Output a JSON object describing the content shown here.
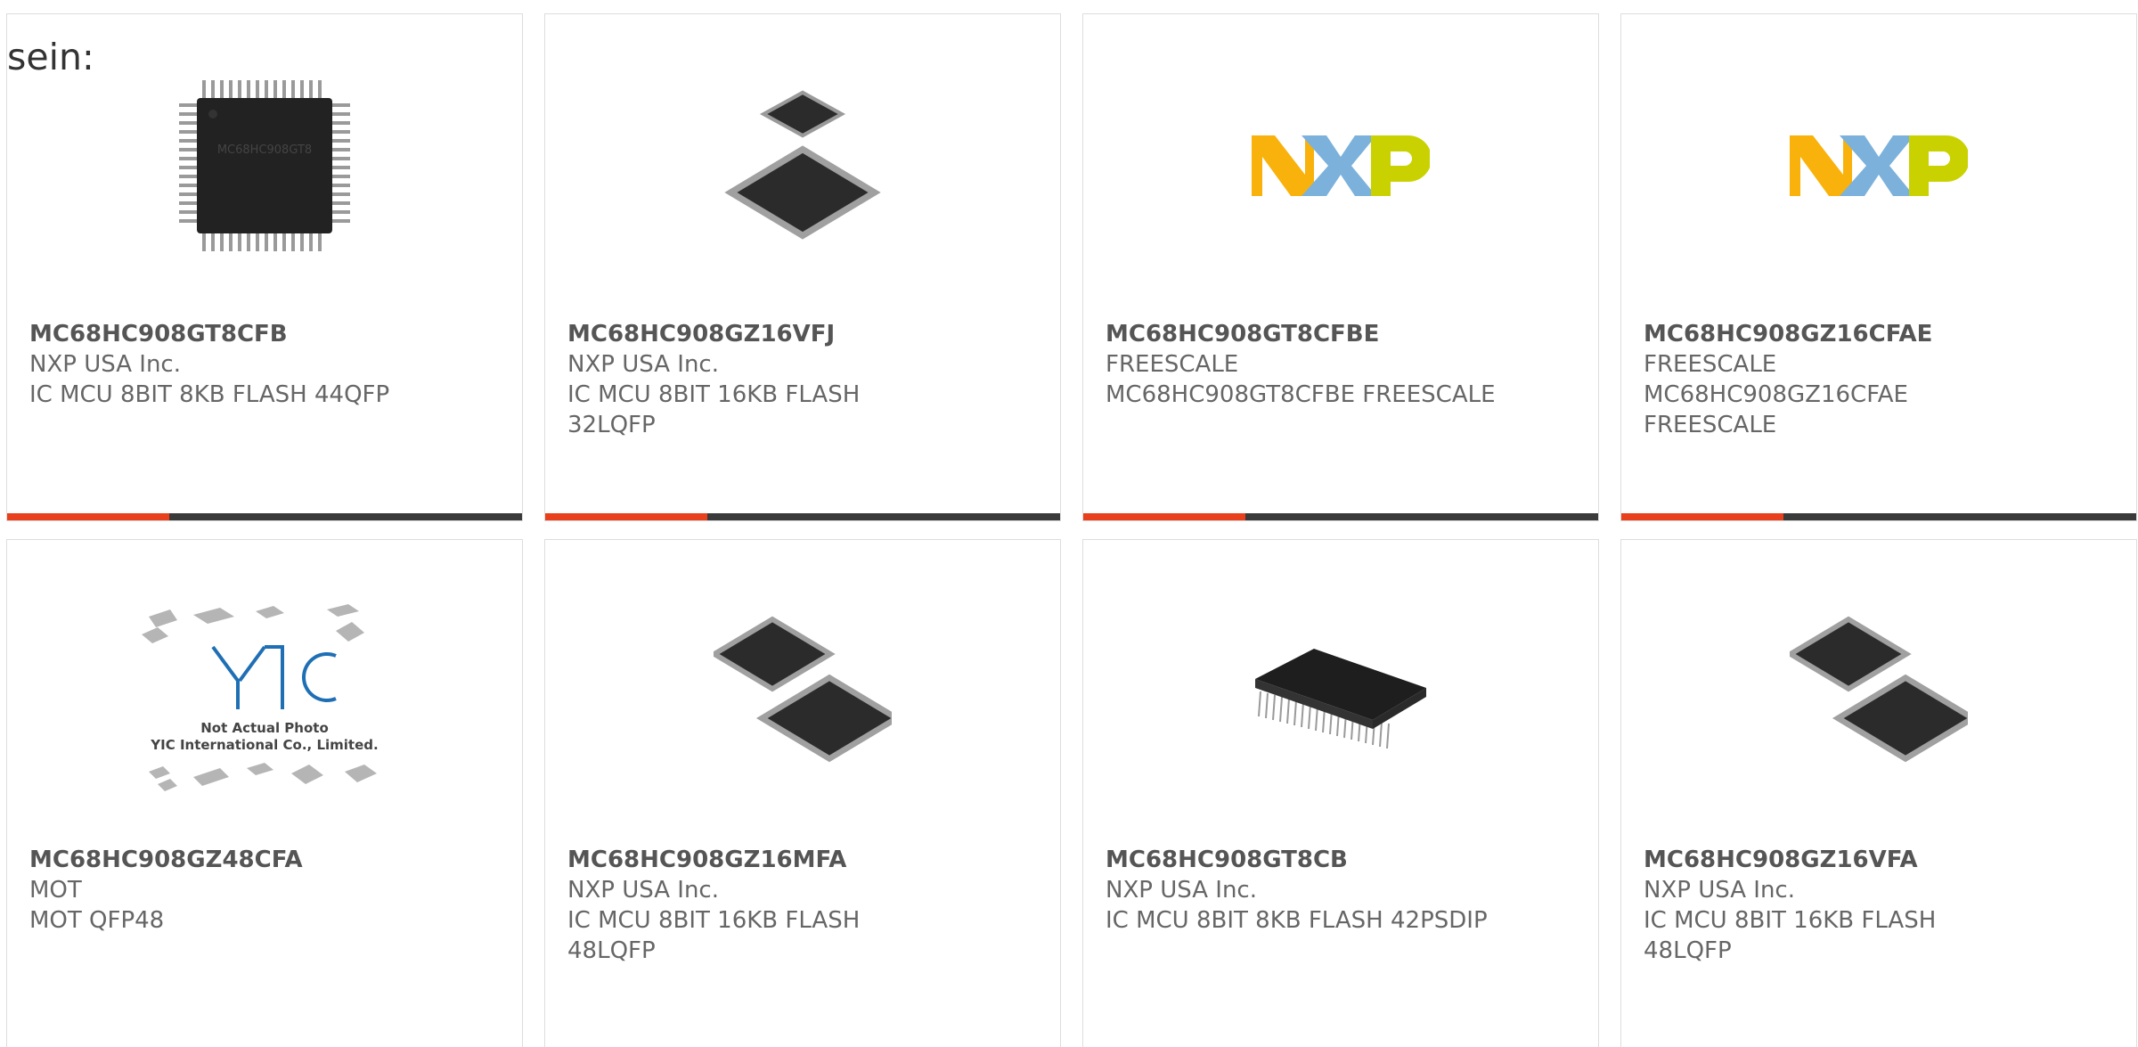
{
  "intro_text": "sein:",
  "products": [
    {
      "part": "MC68HC908GT8CFB",
      "manufacturer": "NXP USA Inc.",
      "description": "IC MCU 8BIT 8KB FLASH 44QFP",
      "image": "qfp-chip-icon"
    },
    {
      "part": "MC68HC908GZ16VFJ",
      "manufacturer": "NXP USA Inc.",
      "description": "IC MCU 8BIT 16KB FLASH 32LQFP",
      "image": "lqfp-chip-pair-icon"
    },
    {
      "part": "MC68HC908GT8CFBE",
      "manufacturer": "FREESCALE",
      "description": "MC68HC908GT8CFBE FREESCALE",
      "image": "nxp-logo"
    },
    {
      "part": "MC68HC908GZ16CFAE",
      "manufacturer": "FREESCALE",
      "description": "MC68HC908GZ16CFAE FREESCALE",
      "image": "nxp-logo"
    },
    {
      "part": "MC68HC908GZ48CFA",
      "manufacturer": "MOT",
      "description": "MOT QFP48",
      "image": "yic-placeholder",
      "placeholder_line1": "Not Actual Photo",
      "placeholder_line2": "YIC International Co., Limited.",
      "placeholder_logo": "YIC"
    },
    {
      "part": "MC68HC908GZ16MFA",
      "manufacturer": "NXP USA Inc.",
      "description": "IC MCU 8BIT 16KB FLASH 48LQFP",
      "image": "lqfp-chip-pair-icon"
    },
    {
      "part": "MC68HC908GT8CB",
      "manufacturer": "NXP USA Inc.",
      "description": "IC MCU 8BIT 8KB FLASH 42PSDIP",
      "image": "sdip-chip-icon"
    },
    {
      "part": "MC68HC908GZ16VFA",
      "manufacturer": "NXP USA Inc.",
      "description": "IC MCU 8BIT 16KB FLASH 48LQFP",
      "image": "lqfp-chip-pair-icon"
    }
  ],
  "colors": {
    "accent": "#e8401c",
    "bar_dark": "#3a3a3a",
    "text": "#666666",
    "part_text": "#555555",
    "nxp_orange": "#f9b20b",
    "nxp_blue": "#7bb1db",
    "nxp_green": "#c9d200"
  }
}
